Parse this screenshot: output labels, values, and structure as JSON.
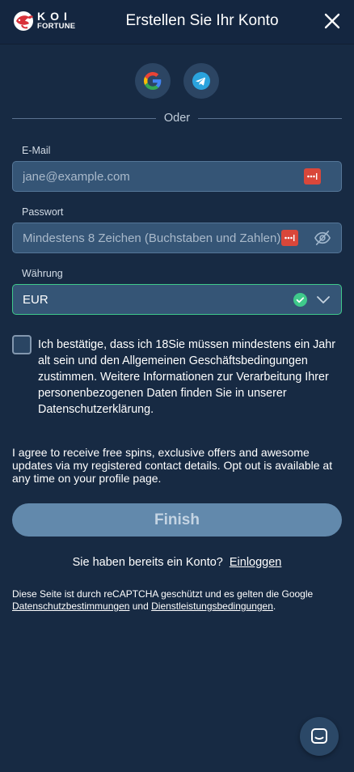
{
  "header": {
    "logo_top": "KOI",
    "logo_bottom": "FORTUNE",
    "title": "Erstellen Sie Ihr Konto"
  },
  "social": {
    "google_icon": "google-icon",
    "telegram_icon": "telegram-icon",
    "divider_text": "Oder"
  },
  "form": {
    "email_label": "E-Mail",
    "email_placeholder": "jane@example.com",
    "password_label": "Passwort",
    "password_placeholder": "Mindestens 8 Zeichen (Buchstaben und Zahlen)",
    "currency_label": "Währung",
    "currency_value": "EUR"
  },
  "terms_text": "Ich bestätige, dass ich 18Sie müssen mindestens ein Jahr alt sein und den Allgemeinen Geschäftsbedingungen zustimmen. Weitere Informationen zur Verarbeitung Ihrer personenbezogenen Daten finden Sie in unserer Datenschutzerklärung.",
  "agree_text": "I agree to receive free spins, exclusive offers and awesome updates via my registered contact details. Opt out is available at any time on your profile page.",
  "finish_label": "Finish",
  "login": {
    "prompt": "Sie haben bereits ein Konto?",
    "link": "Einloggen"
  },
  "recaptcha": {
    "text_before": "Diese Seite ist durch reCAPTCHA geschützt und es gelten die Google ",
    "privacy_link": "Datenschutzbestimmungen",
    "and": " und ",
    "terms_link": "Dienstleistungsbedingungen",
    "text_after": "."
  },
  "colors": {
    "background": "#172a43",
    "field": "#355576",
    "success": "#3fc98b",
    "finish_button": "#6289ac",
    "password_badge": "#d9473a"
  }
}
